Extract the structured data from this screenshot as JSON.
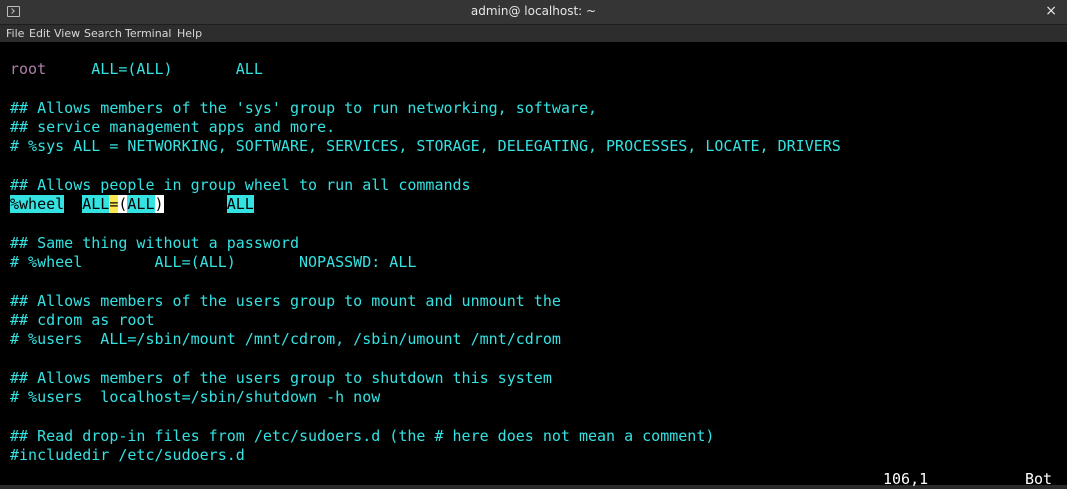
{
  "window": {
    "title": "admin@ localhost: ~",
    "close_glyph": "×"
  },
  "menu": [
    "File",
    "Edit",
    "View",
    "Search",
    "Terminal",
    "Help"
  ],
  "lines": {
    "l0_user": "root",
    "l0_rest": "ALL=(ALL)",
    "l0_all": "ALL",
    "l2": "## Allows members of the 'sys' group to run networking, software,",
    "l3": "## service management apps and more.",
    "l4": "# %sys ALL = NETWORKING, SOFTWARE, SERVICES, STORAGE, DELEGATING, PROCESSES, LOCATE, DRIVERS",
    "l6": "## Allows people in group wheel to run all commands",
    "l7_group": "%wheel",
    "l7_all1": "ALL",
    "l7_eq": "=",
    "l7_paren_open": "(",
    "l7_all2": "ALL",
    "l7_paren_close": ")",
    "l7_all3": "ALL",
    "l9": "## Same thing without a password",
    "l10": "# %wheel        ALL=(ALL)       NOPASSWD: ALL",
    "l12": "## Allows members of the users group to mount and unmount the",
    "l13": "## cdrom as root",
    "l14": "# %users  ALL=/sbin/mount /mnt/cdrom, /sbin/umount /mnt/cdrom",
    "l16": "## Allows members of the users group to shutdown this system",
    "l17": "# %users  localhost=/sbin/shutdown -h now",
    "l19": "## Read drop-in files from /etc/sudoers.d (the # here does not mean a comment)",
    "l20": "#includedir /etc/sudoers.d"
  },
  "status": {
    "position": "106,1",
    "scroll": "Bot"
  },
  "colors": {
    "text": "#34e2e2",
    "user": "#ad7fa8",
    "search_highlight": "#34e2e2",
    "cursor_highlight": "#fce94f",
    "background": "#000000"
  }
}
